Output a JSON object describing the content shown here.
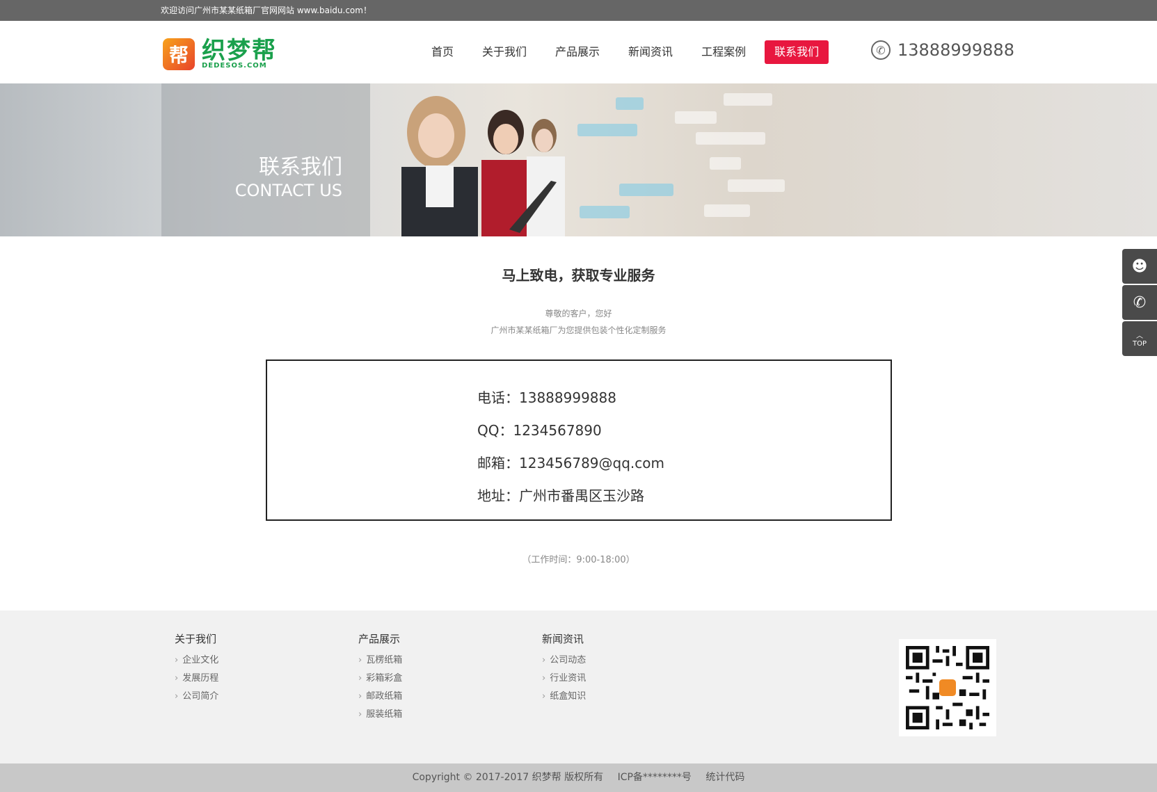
{
  "topbar": {
    "welcome": "欢迎访问广州市某某纸箱厂官网网站 www.baidu.com！"
  },
  "logo": {
    "badge": "帮",
    "cn": "织梦帮",
    "en": "DEDESOS.COM"
  },
  "nav": [
    {
      "label": "首页"
    },
    {
      "label": "关于我们"
    },
    {
      "label": "产品展示"
    },
    {
      "label": "新闻资讯"
    },
    {
      "label": "工程案例"
    },
    {
      "label": "联系我们"
    }
  ],
  "header_phone": "13888999888",
  "banner": {
    "title_cn": "联系我们",
    "title_en": "CONTACT US"
  },
  "main": {
    "title": "马上致电，获取专业服务",
    "sub1": "尊敬的客户，您好",
    "sub2": "广州市某某纸箱厂为您提供包装个性化定制服务"
  },
  "contact": {
    "phone": "电话：13888999888",
    "qq": "QQ：1234567890",
    "email": "邮箱：123456789@qq.com",
    "address": "地址：广州市番禺区玉沙路"
  },
  "hours": "（工作时间：9:00-18:00）",
  "footer": {
    "col1": {
      "title": "关于我们",
      "items": [
        "企业文化",
        "发展历程",
        "公司简介"
      ]
    },
    "col2": {
      "title": "产品展示",
      "items": [
        "瓦楞纸箱",
        "彩箱彩盒",
        "邮政纸箱",
        "服装纸箱"
      ]
    },
    "col3": {
      "title": "新闻资讯",
      "items": [
        "公司动态",
        "行业资讯",
        "纸盒知识"
      ]
    }
  },
  "copyright": {
    "text": "Copyright © 2017-2017 织梦帮 版权所有",
    "icp": "ICP备********号",
    "stats": "统计代码"
  },
  "side": {
    "top_label": "TOP",
    "icons": [
      "qq-icon",
      "phone-icon",
      "top-icon"
    ]
  }
}
